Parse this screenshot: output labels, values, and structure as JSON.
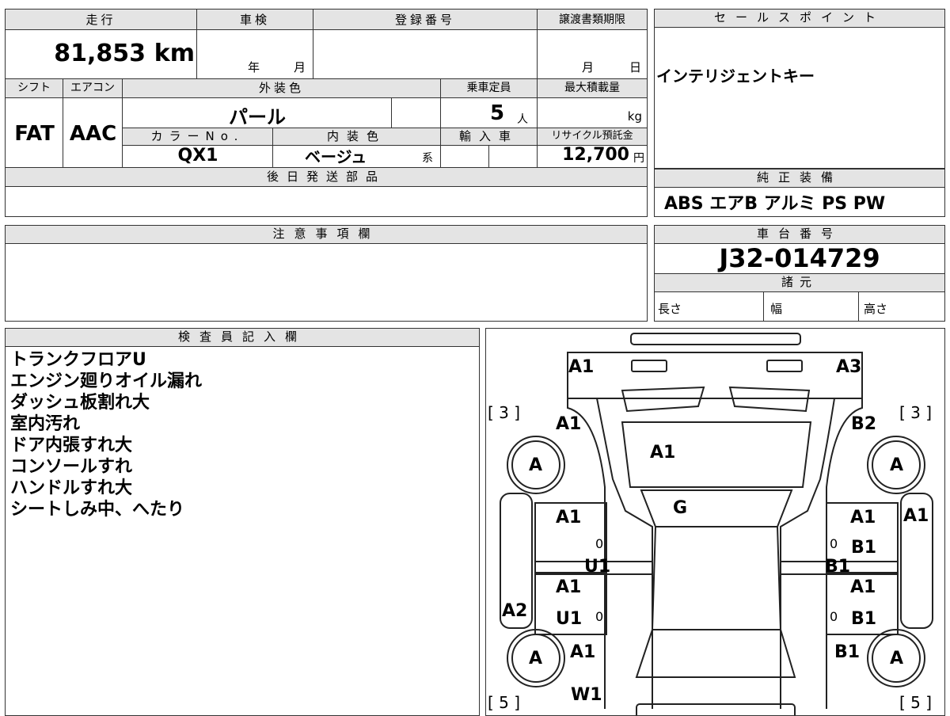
{
  "left_table": {
    "mileage_label": "走行",
    "mileage_value": "81,853",
    "mileage_unit": "km",
    "inspection_label": "車検",
    "year_unit": "年",
    "month_unit": "月",
    "registration_label": "登録番号",
    "transfer_deadline_label": "譲渡書類期限",
    "month_unit2": "月",
    "day_unit": "日",
    "shift_label": "シフト",
    "shift_value": "FAT",
    "ac_label": "エアコン",
    "ac_value": "AAC",
    "exterior_color_label": "外装色",
    "exterior_color_value": "パール",
    "capacity_label": "乗車定員",
    "capacity_value": "5",
    "capacity_unit": "人",
    "max_load_label": "最大積載量",
    "max_load_unit": "kg",
    "color_no_label": "カラーNo.",
    "color_no_value": "QX1",
    "interior_color_label": "内装色",
    "interior_color_value": "ベージュ",
    "interior_suffix": "系",
    "import_label": "輸入車",
    "recycle_label": "リサイクル預託金",
    "recycle_value": "12,700",
    "recycle_unit": "円",
    "later_parts_label": "後日発送部品",
    "notes_label": "注意事項欄"
  },
  "right_panel": {
    "sales_point_label": "セールスポイント",
    "sales_point_value": "インテリジェントキー",
    "equipment_label": "純正装備",
    "equipment_value": "ABS エアB アルミ PS PW",
    "chassis_label": "車台番号",
    "chassis_value": "J32-014729",
    "specs_label": "諸元",
    "length_label": "長さ",
    "width_label": "幅",
    "height_label": "高さ"
  },
  "inspector": {
    "label": "検査員記入欄",
    "lines": [
      "トランクフロアU",
      "エンジン廻りオイル漏れ",
      "ダッシュ板割れ大",
      "室内汚れ",
      "ドア内張すれ大",
      "コンソールすれ",
      "ハンドルすれ大",
      "シートしみ中、へたり"
    ]
  },
  "diagram": {
    "marks": {
      "rear_left": "A1",
      "rear_right": "A3",
      "trunk_left": "A1",
      "trunk_right": "B2",
      "trunk_center": "A1",
      "rear_glass": "G",
      "tire_rl": "A",
      "tire_rr": "A",
      "tire_fl": "A",
      "tire_fr": "A",
      "rear_door_left": "A1",
      "rear_door_right": "A1",
      "side_right": "A1",
      "rdl_zero": "0",
      "rdr_zero": "0",
      "rdr_b1": "B1",
      "u1_left": "U1",
      "b1_right": "B1",
      "front_door_left": "A1",
      "front_door_right": "A1",
      "side_left": "A2",
      "fdl_u1": "U1",
      "fdl_zero": "0",
      "fdr_zero": "0",
      "fdr_b1": "B1",
      "fender_left": "A1",
      "fender_right": "B1",
      "front_w1": "W1",
      "count_rear_left": "[ 3 ]",
      "count_rear_right": "[ 3 ]",
      "count_front_left": "[ 5 ]",
      "count_front_right": "[ 5 ]"
    }
  }
}
